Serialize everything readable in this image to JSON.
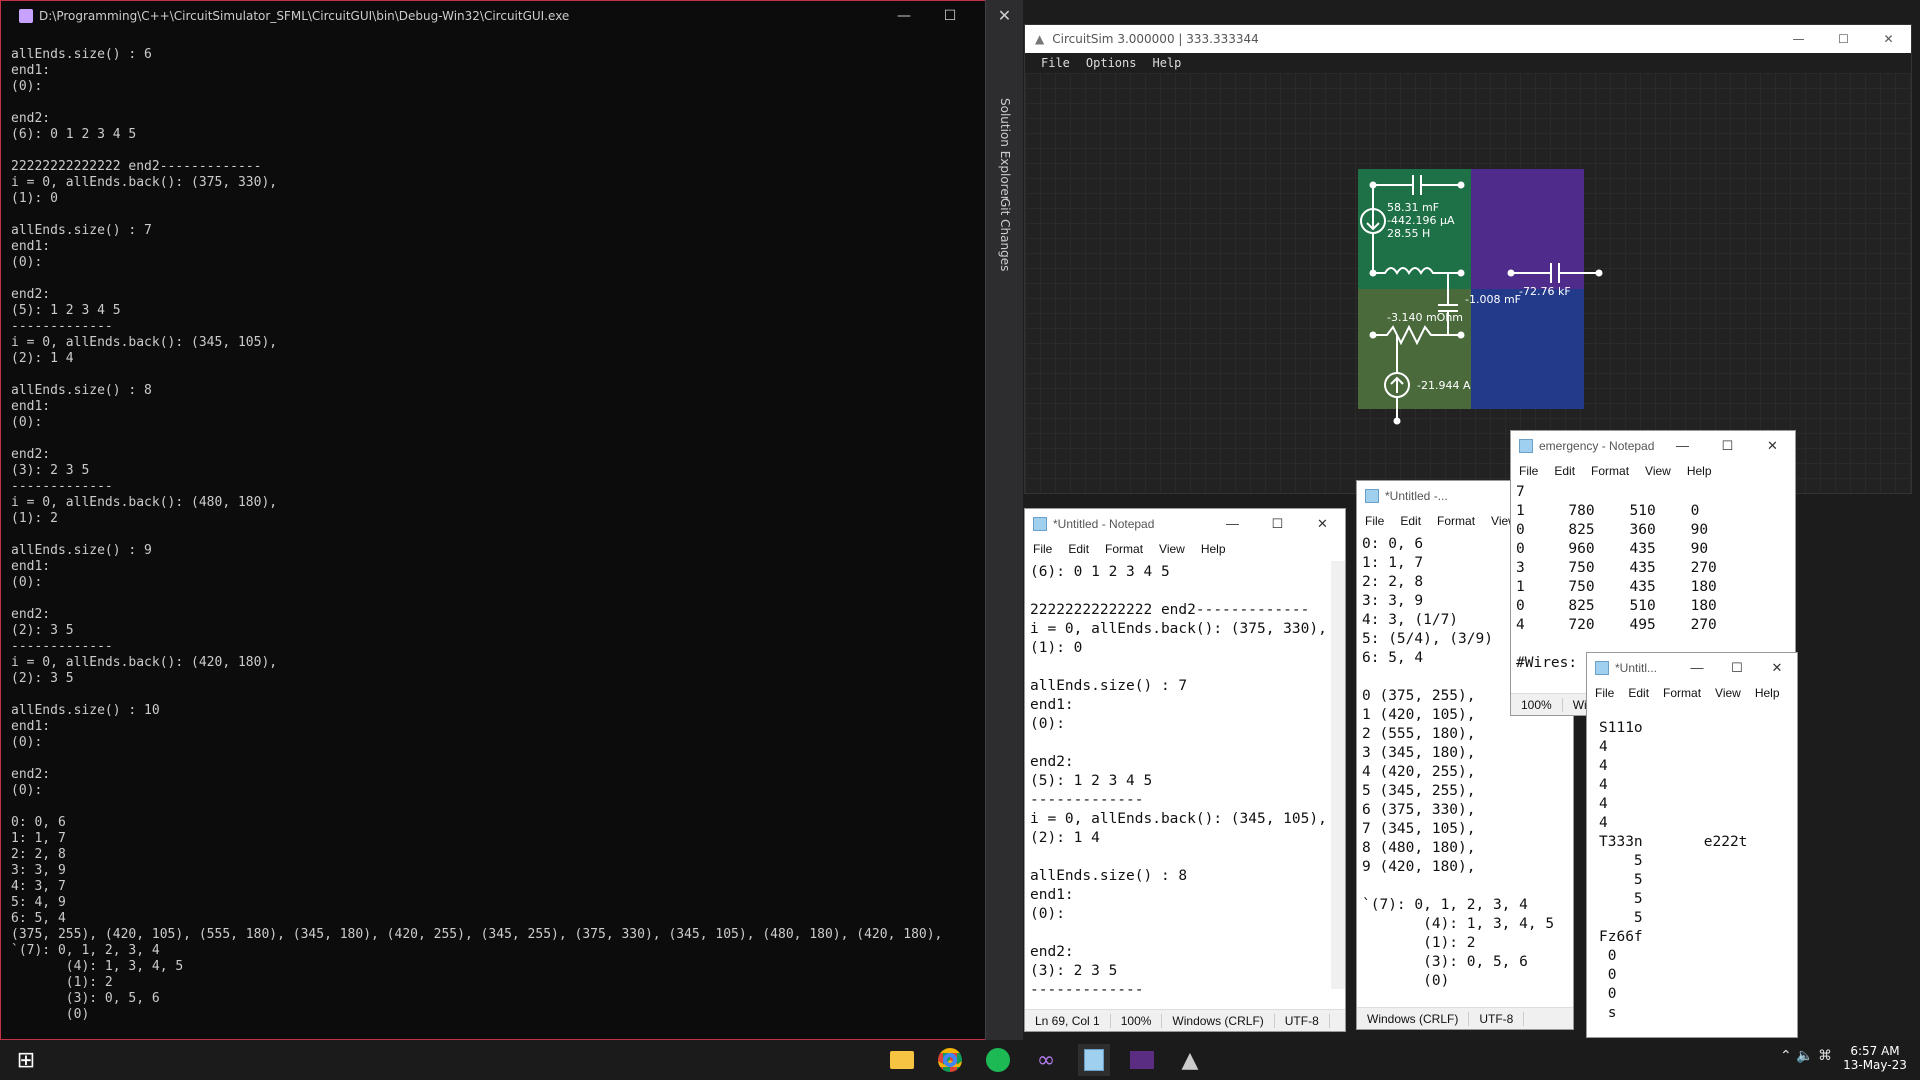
{
  "console": {
    "title": "D:\\Programming\\C++\\CircuitSimulator_SFML\\CircuitGUI\\bin\\Debug-Win32\\CircuitGUI.exe",
    "output": "allEnds.size() : 6\nend1:\n(0):\n\nend2:\n(6): 0 1 2 3 4 5\n\n22222222222222 end2-------------\ni = 0, allEnds.back(): (375, 330),\n(1): 0\n\nallEnds.size() : 7\nend1:\n(0):\n\nend2:\n(5): 1 2 3 4 5\n-------------\ni = 0, allEnds.back(): (345, 105),\n(2): 1 4\n\nallEnds.size() : 8\nend1:\n(0):\n\nend2:\n(3): 2 3 5\n-------------\ni = 0, allEnds.back(): (480, 180),\n(1): 2\n\nallEnds.size() : 9\nend1:\n(0):\n\nend2:\n(2): 3 5\n-------------\ni = 0, allEnds.back(): (420, 180),\n(2): 3 5\n\nallEnds.size() : 10\nend1:\n(0):\n\nend2:\n(0):\n\n0: 0, 6\n1: 1, 7\n2: 2, 8\n3: 3, 9\n4: 3, 7\n5: 4, 9\n6: 5, 4\n(375, 255), (420, 105), (555, 180), (345, 180), (420, 255), (345, 255), (375, 330), (345, 105), (480, 180), (420, 180),\n`(7): 0, 1, 2, 3, 4\n       (4): 1, 3, 4, 5\n       (1): 2\n       (3): 0, 5, 6\n       (0)"
  },
  "ide_strip": {
    "solution_explorer": "Solution Explorer",
    "git_changes": "Git Changes"
  },
  "circuitsim": {
    "title": "CircuitSim  3.000000 | 333.333344",
    "menu": [
      "File",
      "Options",
      "Help"
    ],
    "labels": {
      "cap1": "58.31 mF",
      "cur1": "-442.196 μA",
      "ind1": "28.55 H",
      "cap2": "-72.76 kF",
      "cap3": "-1.008 mF",
      "res1": "-3.140 mOhm",
      "src1": "-21.944 A"
    },
    "colors": {
      "green": "#1e7046",
      "purple": "#4f2b8c",
      "olive": "#4a6a3c",
      "blue": "#233a8a"
    }
  },
  "notepad_untitled1": {
    "title": "*Untitled - Notepad",
    "menu": [
      "File",
      "Edit",
      "Format",
      "View",
      "Help"
    ],
    "text": "(6): 0 1 2 3 4 5\n\n22222222222222 end2-------------\ni = 0, allEnds.back(): (375, 330),\n(1): 0\n\nallEnds.size() : 7\nend1:\n(0):\n\nend2:\n(5): 1 2 3 4 5\n-------------\ni = 0, allEnds.back(): (345, 105),\n(2): 1 4\n\nallEnds.size() : 8\nend1:\n(0):\n\nend2:\n(3): 2 3 5\n-------------",
    "status": [
      "Ln 69, Col 1",
      "100%",
      "Windows (CRLF)",
      "UTF-8"
    ]
  },
  "notepad_untitled2": {
    "title": "*Untitled -...",
    "menu": [
      "File",
      "Edit",
      "Format",
      "View"
    ],
    "text": "0: 0, 6\n1: 1, 7\n2: 2, 8\n3: 3, 9\n4: 3, (1/7)\n5: (5/4), (3/9)\n6: 5, 4\n\n0 (375, 255),\n1 (420, 105),\n2 (555, 180),\n3 (345, 180),\n4 (420, 255),\n5 (345, 255),\n6 (375, 330),\n7 (345, 105),\n8 (480, 180),\n9 (420, 180),\n\n`(7): 0, 1, 2, 3, 4\n       (4): 1, 3, 4, 5\n       (1): 2\n       (3): 0, 5, 6\n       (0)",
    "status": [
      "Windows (CRLF)",
      "UTF-8"
    ]
  },
  "notepad_emergency": {
    "title": "emergency - Notepad",
    "menu": [
      "File",
      "Edit",
      "Format",
      "View",
      "Help"
    ],
    "text": "7\n1     780    510    0\n0     825    360    90\n0     960    435    90\n3     750    435    270\n1     750    435    180\n0     825    510    180\n4     720    495    270\n\n#Wires:",
    "status": [
      "100%",
      "Win"
    ]
  },
  "notepad_untitled3": {
    "title": "*Untitl...",
    "menu": [
      "File",
      "Edit",
      "Format",
      "View",
      "Help"
    ],
    "text": "S111o\n4\n4\n4\n4\n4\nT333n       e222t\n    5\n    5\n    5\n    5\nFz66f\n 0\n 0\n 0\n s"
  },
  "taskbar": {
    "time": "6:57 AM",
    "date": "13-May-23"
  }
}
